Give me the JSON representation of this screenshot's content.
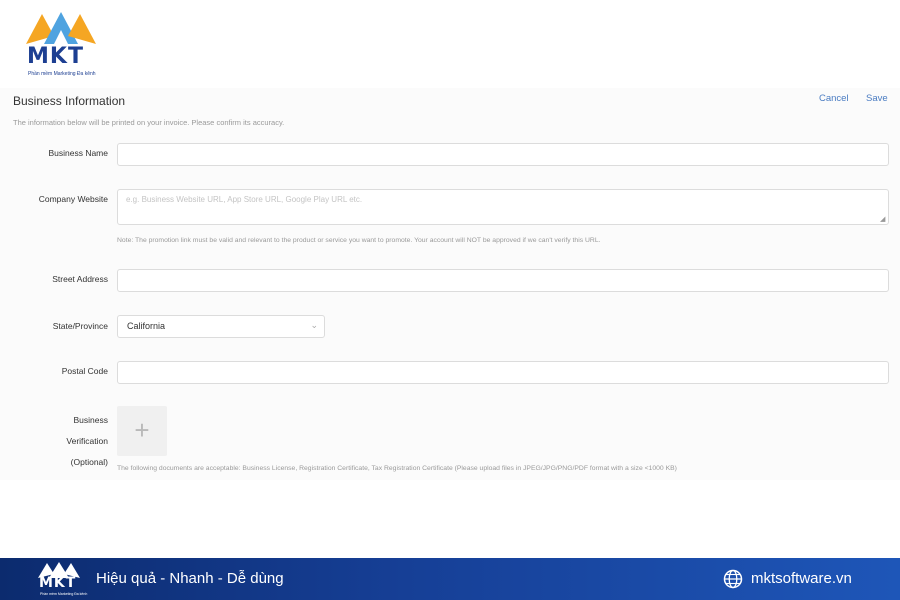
{
  "brand": {
    "logo_text": "MKT",
    "tagline": "Phần mềm Marketing Đa kênh",
    "colors": {
      "blue": "#1d3f92",
      "orange": "#f5a623",
      "light_blue": "#4fa3e0"
    }
  },
  "form": {
    "title": "Business Information",
    "subtitle": "The information below will be printed on your invoice. Please confirm its accuracy.",
    "cancel_label": "Cancel",
    "save_label": "Save",
    "business_name": {
      "label": "Business Name",
      "value": ""
    },
    "company_website": {
      "label": "Company Website",
      "placeholder": "e.g. Business Website URL, App Store URL, Google Play URL etc.",
      "note": "Note: The promotion link must be valid and relevant to the product or service you want to promote. Your account will NOT be approved if we can't verify this URL."
    },
    "street_address": {
      "label": "Street Address",
      "value": ""
    },
    "state_province": {
      "label": "State/Province",
      "value": "California"
    },
    "postal_code": {
      "label": "Postal Code",
      "value": ""
    },
    "business_verification": {
      "label_lines": [
        "Business",
        "Verification",
        "(Optional)"
      ],
      "note": "The following documents are acceptable: Business License, Registration Certificate, Tax Registration Certificate (Please upload files in JPEG/JPG/PNG/PDF format with a size <1000 KB)"
    }
  },
  "footer": {
    "slogan": "Hiệu quả - Nhanh - Dễ dùng",
    "website": "mktsoftware.vn",
    "logo_text": "MKT"
  }
}
